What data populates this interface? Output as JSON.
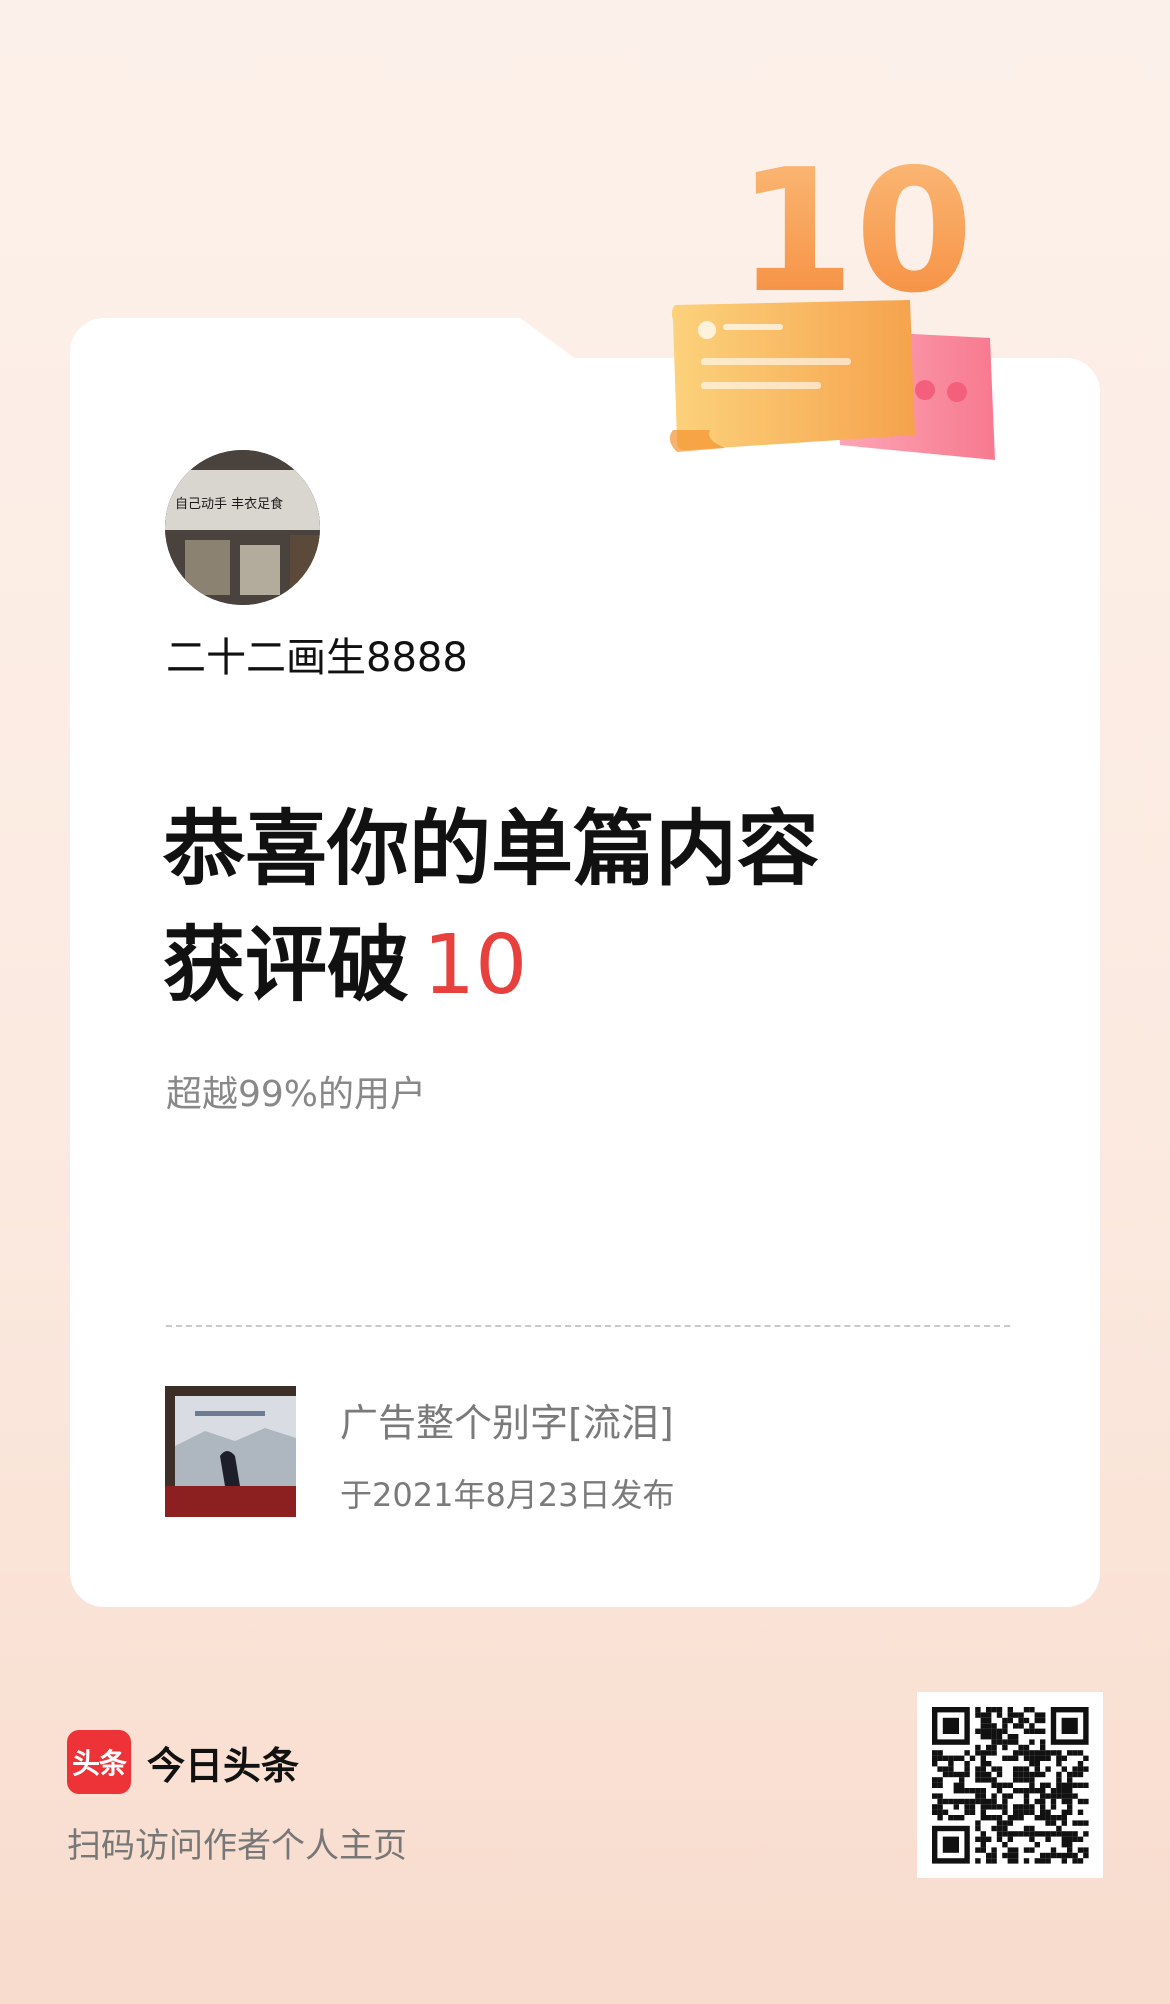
{
  "badge": {
    "number": "10"
  },
  "author": {
    "name": "二十二画生8888",
    "avatar_caption": "自己动手 丰衣足食"
  },
  "headline": {
    "line1": "恭喜你的单篇内容",
    "line2_prefix": "获评破",
    "line2_number": "10"
  },
  "subtitle": "超越99%的用户",
  "article": {
    "title": "广告整个别字[流泪]",
    "date": "于2021年8月23日发布"
  },
  "footer": {
    "logo_text": "头条",
    "brand_name": "今日头条",
    "scan_hint": "扫码访问作者个人主页"
  },
  "colors": {
    "accent": "#e8403d",
    "brand_red": "#ee3338",
    "badge_orange": "#f79a4c"
  }
}
